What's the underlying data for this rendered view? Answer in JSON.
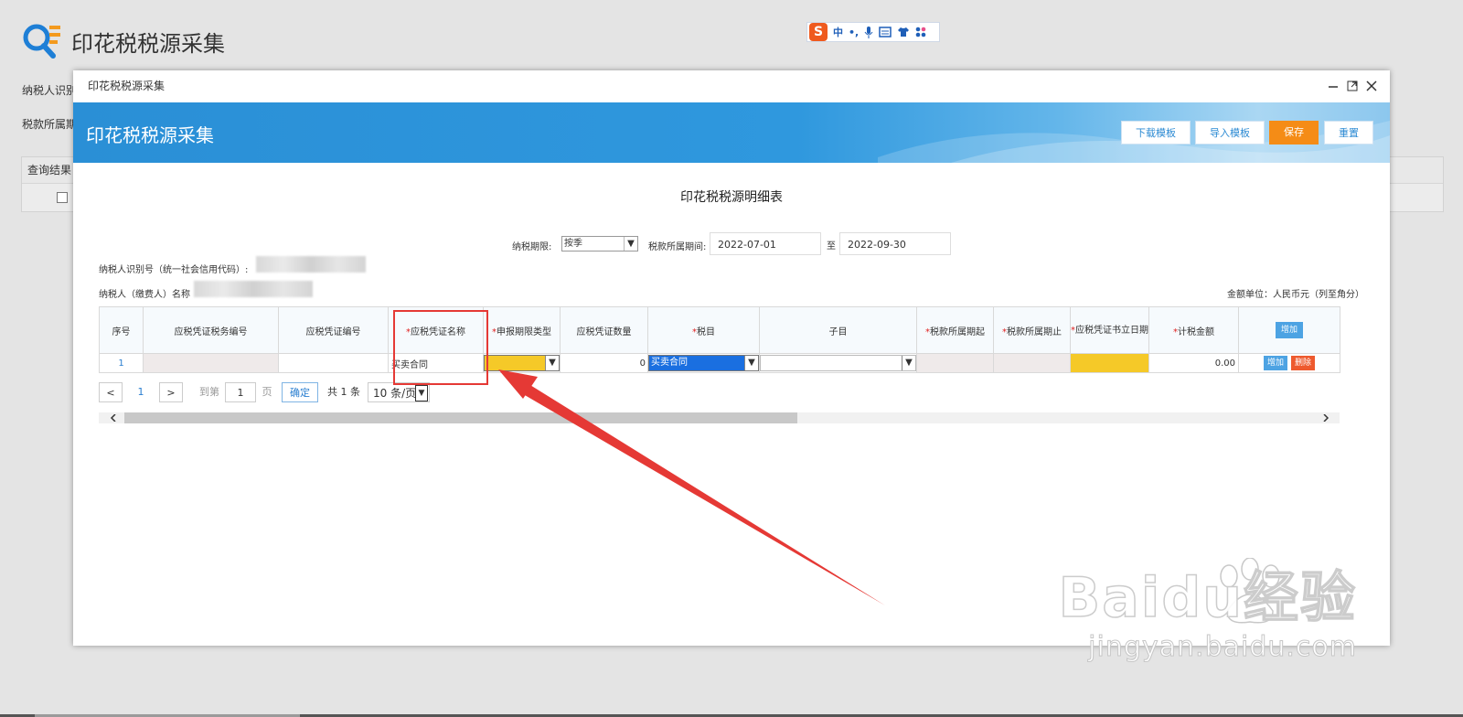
{
  "background": {
    "app_title": "印花税税源采集",
    "label_taxpayer_id": "纳税人识别",
    "label_tax_period": "税款所属期",
    "panel_title": "查询结果"
  },
  "ime_toolbar": {
    "logo": "S",
    "mode": "中",
    "punct": "•,"
  },
  "dialog": {
    "window_title": "印花税税源采集",
    "banner_title": "印花税税源采集",
    "buttons": {
      "download_template": "下载模板",
      "import_template": "导入模板",
      "save": "保存",
      "reset": "重置"
    },
    "table_title": "印花税税源明细表",
    "filters": {
      "period_label": "纳税期限:",
      "period_value": "按季",
      "tax_period_label": "税款所属期间:",
      "start_date": "2022-07-01",
      "to": "至",
      "end_date": "2022-09-30"
    },
    "taxpayer_id_label": "纳税人识别号（统一社会信用代码）:",
    "taxpayer_name_label": "纳税人（缴费人）名称",
    "currency_note": "金额单位：人民币元（列至角分）",
    "columns": [
      {
        "label": "序号",
        "required": false
      },
      {
        "label": "应税凭证税务编号",
        "required": false
      },
      {
        "label": "应税凭证编号",
        "required": false
      },
      {
        "label": "应税凭证名称",
        "required": true
      },
      {
        "label": "申报期限类型",
        "required": true
      },
      {
        "label": "应税凭证数量",
        "required": false
      },
      {
        "label": "税目",
        "required": true
      },
      {
        "label": "子目",
        "required": false
      },
      {
        "label": "税款所属期起",
        "required": true
      },
      {
        "label": "税款所属期止",
        "required": true
      },
      {
        "label": "应税凭证书立日期",
        "required": true
      },
      {
        "label": "计税金额",
        "required": true
      }
    ],
    "header_add_button": "增加",
    "rows": [
      {
        "index": "1",
        "voucher_name": "买卖合同",
        "quantity": "0",
        "tax_item": "买卖合同",
        "amount": "0.00",
        "add": "增加",
        "delete": "删除"
      }
    ],
    "pagination": {
      "prev": "<",
      "current_page": "1",
      "next": ">",
      "goto_label": "到第",
      "goto_value": "1",
      "page_unit": "页",
      "confirm": "确定",
      "total": "共 1 条",
      "page_size": "10 条/页"
    }
  },
  "watermark": {
    "brand": "Baidu经验",
    "url": "jingyan.baidu.com"
  }
}
